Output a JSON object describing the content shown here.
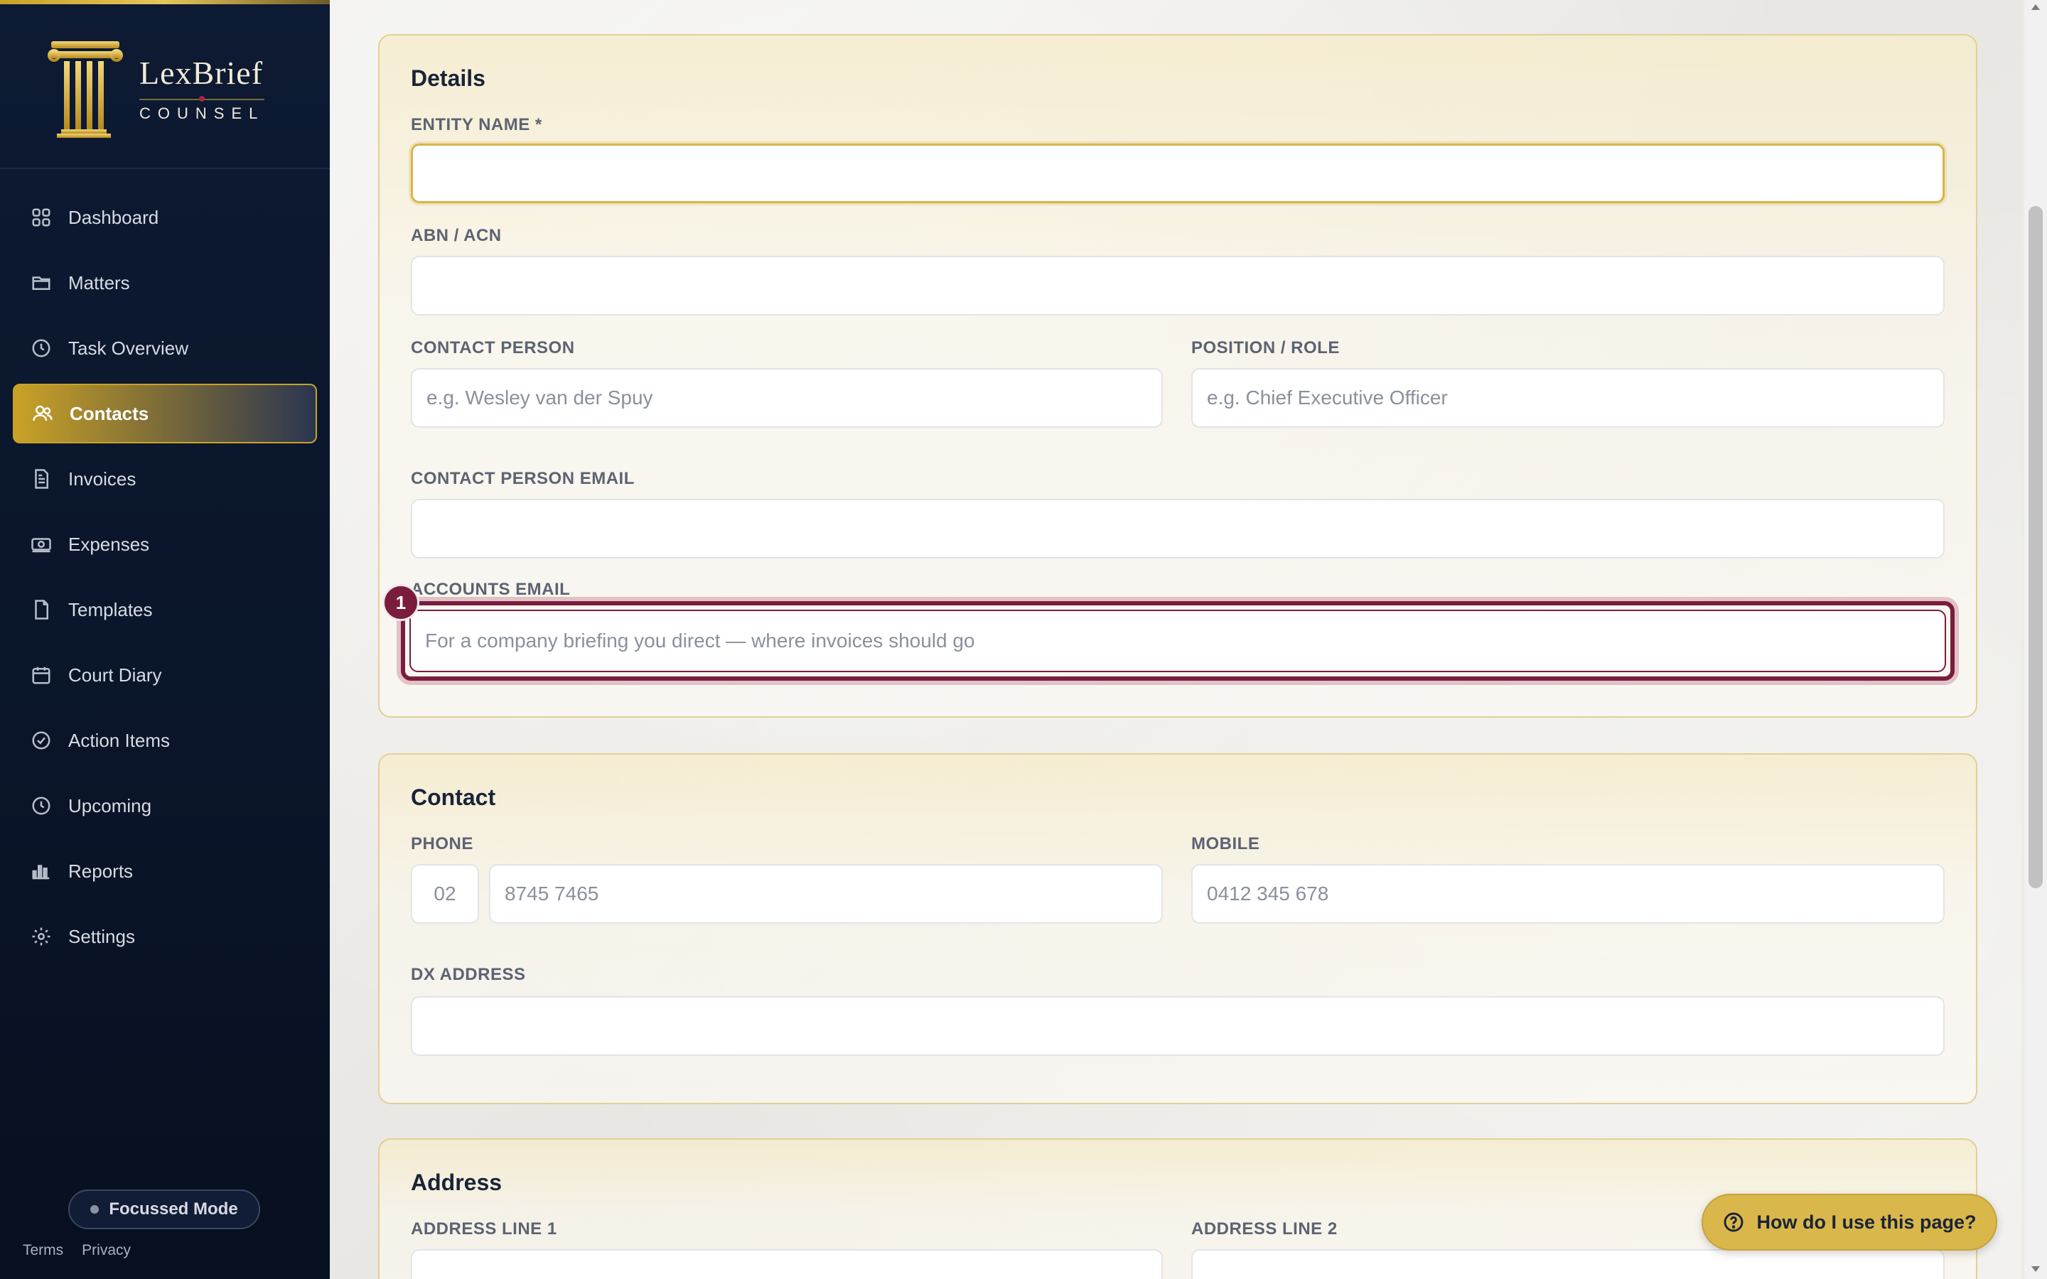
{
  "brand": {
    "name": "LexBrief",
    "sub": "COUNSEL"
  },
  "nav": [
    {
      "label": "Dashboard",
      "icon": "dashboard-icon",
      "active": false
    },
    {
      "label": "Matters",
      "icon": "folder-icon",
      "active": false
    },
    {
      "label": "Task Overview",
      "icon": "clock-icon",
      "active": false
    },
    {
      "label": "Contacts",
      "icon": "users-icon",
      "active": true
    },
    {
      "label": "Invoices",
      "icon": "document-icon",
      "active": false
    },
    {
      "label": "Expenses",
      "icon": "money-icon",
      "active": false
    },
    {
      "label": "Templates",
      "icon": "file-icon",
      "active": false
    },
    {
      "label": "Court Diary",
      "icon": "calendar-icon",
      "active": false
    },
    {
      "label": "Action Items",
      "icon": "check-circle-icon",
      "active": false
    },
    {
      "label": "Upcoming",
      "icon": "clock-icon",
      "active": false
    },
    {
      "label": "Reports",
      "icon": "bar-chart-icon",
      "active": false
    },
    {
      "label": "Settings",
      "icon": "gear-icon",
      "active": false
    }
  ],
  "sidebar_footer": {
    "focus_mode": "Focussed Mode",
    "terms": "Terms",
    "privacy": "Privacy"
  },
  "details": {
    "title": "Details",
    "entity_name_label": "ENTITY NAME *",
    "entity_name_value": "",
    "abn_label": "ABN / ACN",
    "abn_value": "",
    "contact_person_label": "CONTACT PERSON",
    "contact_person_placeholder": "e.g. Wesley van der Spuy",
    "position_label": "POSITION / ROLE",
    "position_placeholder": "e.g. Chief Executive Officer",
    "contact_email_label": "CONTACT PERSON EMAIL",
    "contact_email_value": "",
    "accounts_email_label": "ACCOUNTS EMAIL",
    "accounts_email_placeholder": "For a company briefing you direct — where invoices should go",
    "highlight_badge": "1"
  },
  "contact": {
    "title": "Contact",
    "phone_label": "PHONE",
    "phone_area_placeholder": "02",
    "phone_number_placeholder": "8745 7465",
    "mobile_label": "MOBILE",
    "mobile_placeholder": "0412 345 678",
    "dx_label": "DX ADDRESS",
    "dx_value": ""
  },
  "address": {
    "title": "Address",
    "line1_label": "ADDRESS LINE 1",
    "line2_label": "ADDRESS LINE 2"
  },
  "help": {
    "label": "How do I use this page?"
  },
  "colors": {
    "accent_gold": "#d9b74a",
    "highlight_maroon": "#7a1d3c",
    "sidebar_navy": "#0d1a33"
  }
}
